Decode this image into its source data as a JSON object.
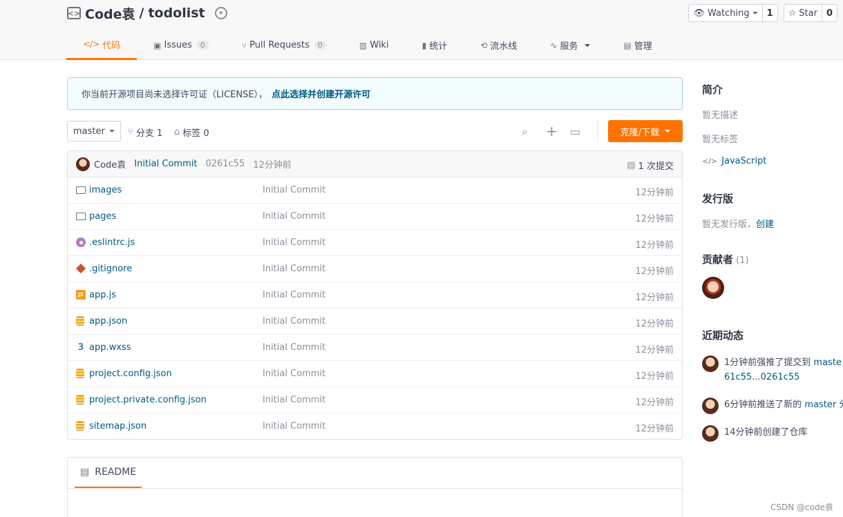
{
  "repo": {
    "owner": "Code袁",
    "separator": "/",
    "name": "todolist"
  },
  "watch": {
    "label": "Watching",
    "count": "1"
  },
  "star": {
    "label": "Star",
    "count": "0"
  },
  "tabs": [
    {
      "label": "代码",
      "icon": "</>"
    },
    {
      "label": "Issues",
      "count": "0"
    },
    {
      "label": "Pull Requests",
      "count": "0"
    },
    {
      "label": "Wiki"
    },
    {
      "label": "统计"
    },
    {
      "label": "流水线"
    },
    {
      "label": "服务"
    },
    {
      "label": "管理"
    }
  ],
  "notice": {
    "text": "你当前开源项目尚未选择许可证（LICENSE），",
    "link": "点此选择并创建开源许可"
  },
  "toolbar": {
    "branch": "master",
    "branches": "分支 1",
    "tags": "标签 0",
    "clone": "克隆/下载"
  },
  "commit": {
    "author": "Code袁",
    "message": "Initial Commit",
    "sha": "0261c55",
    "time": "12分钟前",
    "count": "1 次提交"
  },
  "files": [
    {
      "name": "images",
      "msg": "Initial Commit",
      "time": "12分钟前",
      "icon": "folder-icon"
    },
    {
      "name": "pages",
      "msg": "Initial Commit",
      "time": "12分钟前",
      "icon": "folder-icon"
    },
    {
      "name": ".eslintrc.js",
      "msg": "Initial Commit",
      "time": "12分钟前",
      "icon": "eslint-icon"
    },
    {
      "name": ".gitignore",
      "msg": "Initial Commit",
      "time": "12分钟前",
      "icon": "git-icon"
    },
    {
      "name": "app.js",
      "msg": "Initial Commit",
      "time": "12分钟前",
      "icon": "js-icon"
    },
    {
      "name": "app.json",
      "msg": "Initial Commit",
      "time": "12分钟前",
      "icon": "json-icon"
    },
    {
      "name": "app.wxss",
      "msg": "Initial Commit",
      "time": "12分钟前",
      "icon": "css-icon"
    },
    {
      "name": "project.config.json",
      "msg": "Initial Commit",
      "time": "12分钟前",
      "icon": "json-icon"
    },
    {
      "name": "project.private.config.json",
      "msg": "Initial Commit",
      "time": "12分钟前",
      "icon": "json-icon"
    },
    {
      "name": "sitemap.json",
      "msg": "Initial Commit",
      "time": "12分钟前",
      "icon": "json-icon"
    }
  ],
  "readme": {
    "label": "README"
  },
  "sidebar": {
    "intro_title": "简介",
    "no_desc": "暂无描述",
    "no_tags": "暂无标签",
    "language": "JavaScript",
    "release_title": "发行版",
    "no_release": "暂无发行版，",
    "create": "创建",
    "contrib_title": "贡献者",
    "contrib_count": "(1)",
    "activity_title": "近期动态",
    "activities": [
      {
        "text": "1分钟前强推了提交到",
        "link": "maste",
        "line2": "61c55...0261c55"
      },
      {
        "text": "6分钟前推送了新的",
        "link": "master 分"
      },
      {
        "text": "14分钟前创建了仓库"
      }
    ]
  },
  "watermark": "CSDN @code袁",
  "icon_chars": {
    "watch": "👁",
    "star": "☆",
    "search": "⌕",
    "plus": "+",
    "monitor": "▭",
    "commits": "▤",
    "code": "</>",
    "branch": "⑂",
    "tag": "⌂"
  }
}
